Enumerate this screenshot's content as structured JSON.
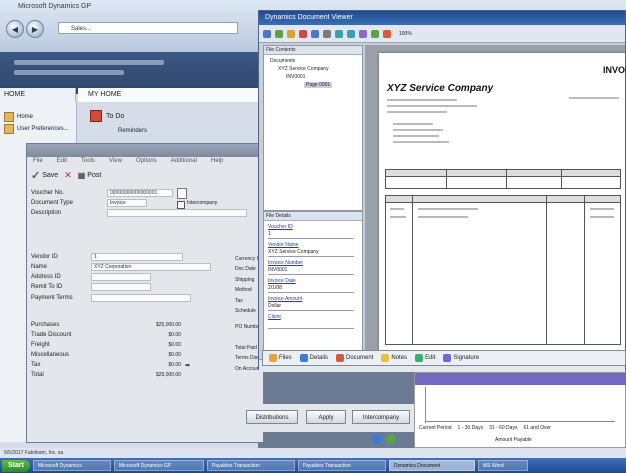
{
  "browser": {
    "title": "Microsoft Dynamics GP",
    "address": "Sales..."
  },
  "home": {
    "tab_label": "HOME",
    "page_title": "MY HOME",
    "todo_label": "To Do",
    "reminders_label": "Reminders",
    "nav_items": [
      "Home",
      "User Preferences..."
    ]
  },
  "payables": {
    "menu": [
      "File",
      "Edit",
      "Tools",
      "View",
      "Options",
      "Additional",
      "Help"
    ],
    "tools": {
      "save": "Save",
      "delete": "",
      "post": "Post"
    },
    "fields": {
      "voucher_no_label": "Voucher No.",
      "voucher_no_value": "00000000000000001",
      "document_type_label": "Document Type",
      "document_type_value": "Invoice",
      "description_label": "Description",
      "intercompany_label": "Intercompany",
      "vendor_id_label": "Vendor ID",
      "vendor_id_value": "1",
      "name_label": "Name",
      "name_value": "XYZ Corporation",
      "address_id_label": "Address ID",
      "remit_to_label": "Remit To ID",
      "payment_terms_label": "Payment Terms",
      "purchases_label": "Purchases",
      "purchases_value": "$25,000.00",
      "trade_discount_label": "Trade Discount",
      "trade_discount_value": "$0.00",
      "freight_label": "Freight",
      "freight_value": "$0.00",
      "misc_label": "Miscellaneous",
      "misc_value": "$0.00",
      "tax_label": "Tax",
      "tax_value": "$0.00",
      "total_label": "Total",
      "total_value": "$25,000.00",
      "right_labels": [
        "Currency ID",
        "Doc Date",
        "Shipping Method",
        "Tax Schedule",
        "PO Number",
        "Total Paid",
        "Terms Disc",
        "On Account"
      ]
    },
    "buttons": {
      "distributions": "Distributions",
      "apply": "Apply",
      "intercompany": "Intercompany"
    }
  },
  "viewer": {
    "title": "Dynamics Document Viewer",
    "zoom": "100%",
    "contents_title": "File Contents",
    "tree": [
      "Documents",
      "XYZ Service Company",
      "INV0001",
      "Page 0001"
    ],
    "details_title": "File Details",
    "details": [
      {
        "label": "Voucher ID",
        "value": "1"
      },
      {
        "label": "Vendor Name",
        "value": "XYZ Service Company"
      },
      {
        "label": "Invoice Number",
        "value": "INV0001"
      },
      {
        "label": "Invoice Date",
        "value": "2/1/08"
      },
      {
        "label": "Invoice Amount",
        "value": "Dollar"
      },
      {
        "label": "Client",
        "value": ""
      }
    ],
    "invoice_heading": "INVOICE",
    "company": "XYZ Service Company",
    "bottom_items": [
      {
        "label": "Files",
        "color": "#e8a33b"
      },
      {
        "label": "Details",
        "color": "#3b7bd8"
      },
      {
        "label": "Document",
        "color": "#d85a3b"
      },
      {
        "label": "Notes",
        "color": "#e8c23b"
      },
      {
        "label": "Edit",
        "color": "#3bb06a"
      },
      {
        "label": "Signature",
        "color": "#6a6ad8"
      }
    ]
  },
  "aging": {
    "legend": [
      "Current Period",
      "1 - 30 Days",
      "31 - 60 Days",
      "61 and Over"
    ],
    "x_title": "Amount Payable"
  },
  "status_bar": "5/5/2017  Fabrikam, Inc.  sa",
  "taskbar": {
    "start": "Start",
    "tasks": [
      "Microsoft Dynamics",
      "Microsoft Dynamics GP",
      "Payables Transaction",
      "Payables Transaction",
      "Dynamics Document",
      "MS Word"
    ]
  }
}
